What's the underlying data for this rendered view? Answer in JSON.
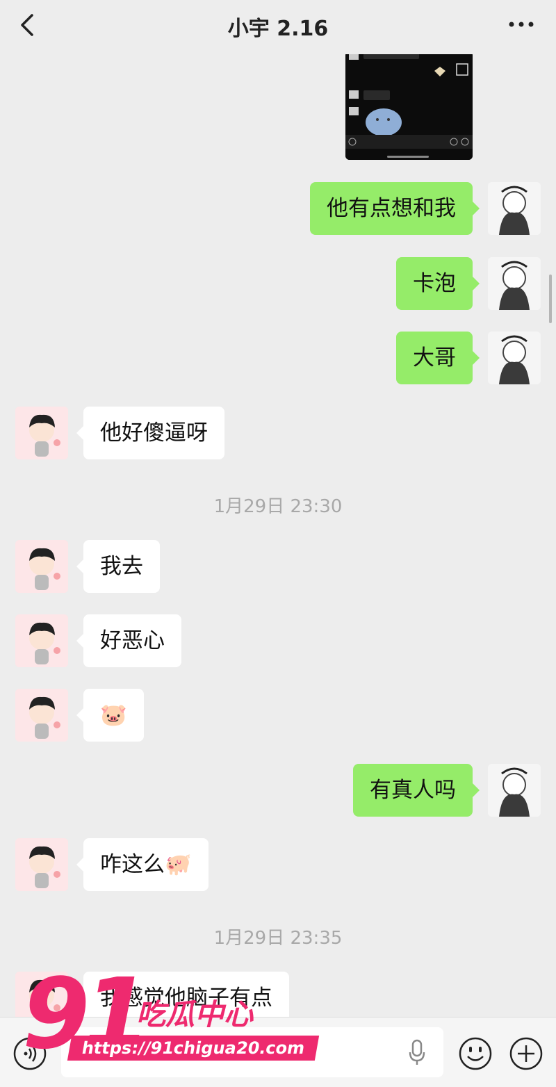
{
  "header": {
    "title": "小宇 2.16",
    "back_icon": "chevron-left-icon",
    "more_icon": "more-dots-icon"
  },
  "messages": [
    {
      "side": "me",
      "text": "他有点想和我"
    },
    {
      "side": "me",
      "text": "卡泡"
    },
    {
      "side": "me",
      "text": "大哥"
    },
    {
      "side": "friend",
      "text": "他好傻逼呀"
    },
    {
      "type": "timestamp",
      "text": "1月29日 23:30"
    },
    {
      "side": "friend",
      "text": "我去"
    },
    {
      "side": "friend",
      "text": "好恶心"
    },
    {
      "side": "friend",
      "text": "🐷"
    },
    {
      "side": "me",
      "text": "有真人吗"
    },
    {
      "side": "friend",
      "text": "咋这么🐖"
    },
    {
      "type": "timestamp",
      "text": "1月29日 23:35"
    },
    {
      "side": "friend",
      "text": "我感觉他脑子有点"
    }
  ],
  "input_bar": {
    "voice_icon": "voice-icon",
    "mic_icon": "microphone-icon",
    "emoji_icon": "emoji-icon",
    "plus_icon": "plus-icon"
  },
  "watermark": {
    "number": "91",
    "name": "吃瓜中心",
    "url": "https://91chigua20.com"
  }
}
